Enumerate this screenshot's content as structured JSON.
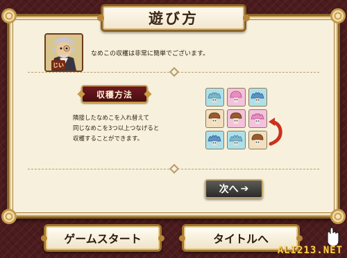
{
  "title": "遊び方",
  "character": {
    "name_label": "じい",
    "icon": "elderly-butler-portrait"
  },
  "intro_text": "なめこの収穫は非常に簡単でございます。",
  "section": {
    "label": "収穫方法",
    "description_lines": [
      "隣接したなめこを入れ替えて",
      "同じなめこを3つ以上つなげると",
      "収穫することができます。"
    ]
  },
  "puzzle_tiles": [
    [
      "blue-frilly-nameko",
      "pink-frilly-nameko",
      "blue-frilly-nameko"
    ],
    [
      "brown-nameko",
      "brown-nameko",
      "pink-frilly-nameko"
    ],
    [
      "blue-frilly-nameko",
      "blue-frilly-nameko",
      "brown-nameko"
    ]
  ],
  "swap_arrow_icon": "red-curved-arrow-icon",
  "next_button": {
    "label": "次へ",
    "icon": "arrow-right-icon"
  },
  "buttons": {
    "game_start": "ゲームスタート",
    "to_title": "タイトルへ"
  },
  "watermark": "ALI213.NET",
  "colors": {
    "background": "#4b1b1d",
    "panel": "#f7f0dc",
    "frame_gold": "#c49a4b",
    "section_label_bg": "#6d1a1f",
    "next_button_bg": "#3a3a37"
  }
}
